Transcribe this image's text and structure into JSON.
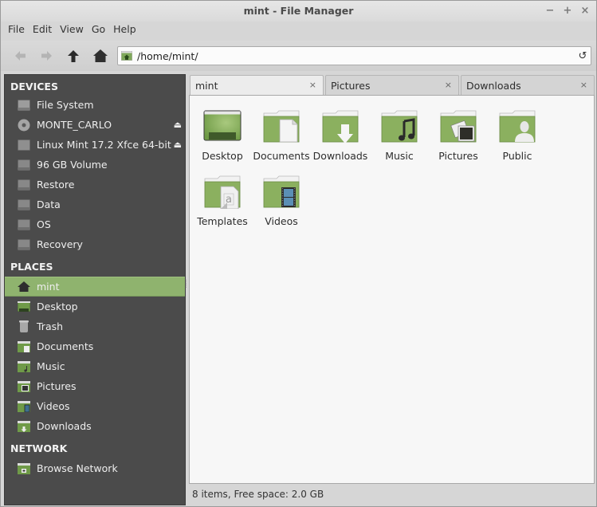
{
  "window": {
    "title": "mint - File Manager",
    "controls": {
      "minimize": "−",
      "maximize": "+",
      "close": "×"
    }
  },
  "menubar": [
    "File",
    "Edit",
    "View",
    "Go",
    "Help"
  ],
  "toolbar": {
    "back_icon": "arrow-left-icon",
    "forward_icon": "arrow-right-icon",
    "up_icon": "arrow-up-icon",
    "home_icon": "home-icon",
    "location_path": "/home/mint/",
    "reload_icon": "reload-icon",
    "reload_glyph": "↺"
  },
  "sidebar": {
    "devices_header": "DEVICES",
    "devices": [
      {
        "label": "File System",
        "icon": "harddisk-icon",
        "eject": false
      },
      {
        "label": "MONTE_CARLO",
        "icon": "optical-disc-icon",
        "eject": true
      },
      {
        "label": "Linux Mint 17.2 Xfce 64-bit",
        "icon": "removable-drive-icon",
        "eject": true
      },
      {
        "label": "96 GB Volume",
        "icon": "harddisk-icon",
        "eject": false
      },
      {
        "label": "Restore",
        "icon": "harddisk-icon",
        "eject": false
      },
      {
        "label": "Data",
        "icon": "harddisk-icon",
        "eject": false
      },
      {
        "label": "OS",
        "icon": "harddisk-icon",
        "eject": false
      },
      {
        "label": "Recovery",
        "icon": "harddisk-icon",
        "eject": false
      }
    ],
    "eject_glyph": "⏏",
    "places_header": "PLACES",
    "places": [
      {
        "label": "mint",
        "icon": "home-icon",
        "active": true
      },
      {
        "label": "Desktop",
        "icon": "desktop-icon",
        "active": false
      },
      {
        "label": "Trash",
        "icon": "trash-icon",
        "active": false
      },
      {
        "label": "Documents",
        "icon": "folder-documents-icon",
        "active": false
      },
      {
        "label": "Music",
        "icon": "folder-music-icon",
        "active": false
      },
      {
        "label": "Pictures",
        "icon": "folder-pictures-icon",
        "active": false
      },
      {
        "label": "Videos",
        "icon": "folder-videos-icon",
        "active": false
      },
      {
        "label": "Downloads",
        "icon": "folder-downloads-icon",
        "active": false
      }
    ],
    "network_header": "NETWORK",
    "network": [
      {
        "label": "Browse Network",
        "icon": "network-folder-icon"
      }
    ]
  },
  "tabs": [
    {
      "label": "mint",
      "active": true,
      "close": "×"
    },
    {
      "label": "Pictures",
      "active": false,
      "close": "×"
    },
    {
      "label": "Downloads",
      "active": false,
      "close": "×"
    }
  ],
  "content": {
    "items": [
      {
        "label": "Desktop",
        "icon": "desktop-folder-icon"
      },
      {
        "label": "Documents",
        "icon": "folder-documents-icon"
      },
      {
        "label": "Downloads",
        "icon": "folder-downloads-icon"
      },
      {
        "label": "Music",
        "icon": "folder-music-icon"
      },
      {
        "label": "Pictures",
        "icon": "folder-pictures-icon"
      },
      {
        "label": "Public",
        "icon": "folder-public-icon"
      },
      {
        "label": "Templates",
        "icon": "folder-templates-icon"
      },
      {
        "label": "Videos",
        "icon": "folder-videos-icon"
      }
    ]
  },
  "statusbar": {
    "text": "8 items, Free space: 2.0 GB"
  },
  "colors": {
    "accent_green": "#8fb36e",
    "folder_green": "#8bb05f",
    "sidebar_bg": "#4b4b4b"
  }
}
